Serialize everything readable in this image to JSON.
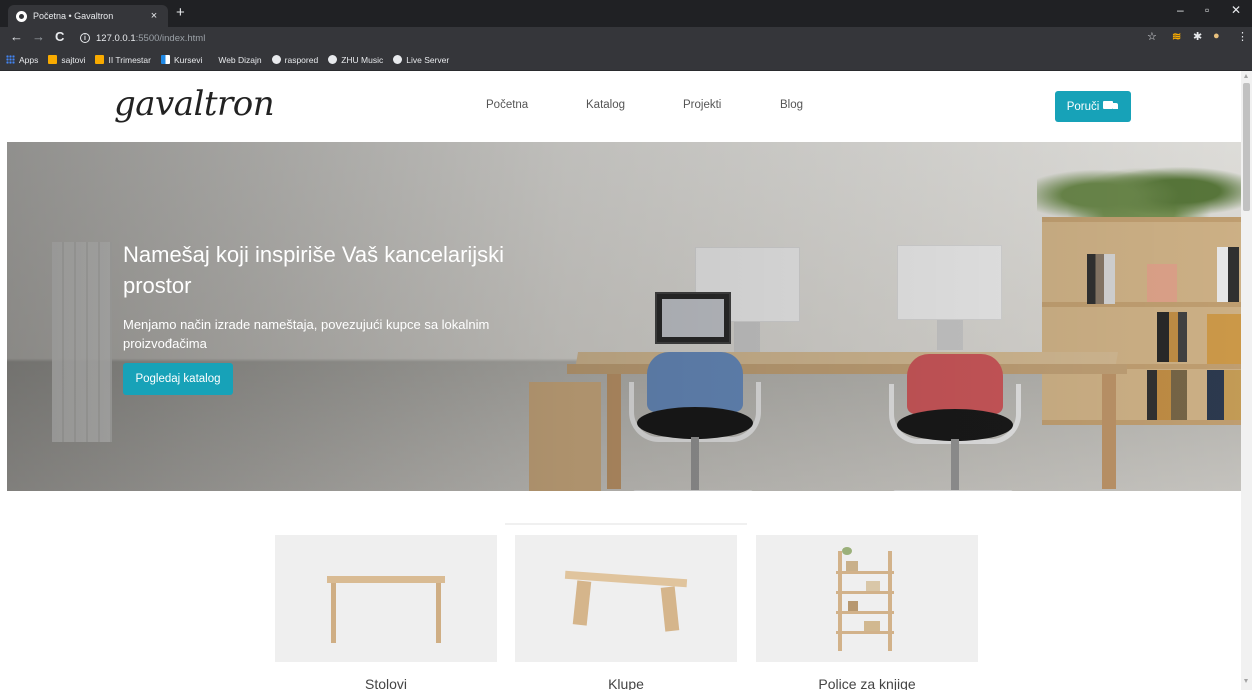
{
  "browser": {
    "tab_title": "Početna • Gavaltron",
    "tab_close": "×",
    "new_tab": "+",
    "url_host": "127.0.0.1",
    "url_path": ":5500/index.html",
    "bookmarks": [
      {
        "label": "Apps",
        "icon": "apps-grid-icon"
      },
      {
        "label": "sajtovi",
        "icon": "folder-icon"
      },
      {
        "label": "II Trimestar",
        "icon": "folder-icon"
      },
      {
        "label": "Kursevi",
        "icon": "ms-icon"
      },
      {
        "label": "Web Dizajn",
        "icon": "none"
      },
      {
        "label": "raspored",
        "icon": "globe-icon"
      },
      {
        "label": "ZHU Music",
        "icon": "globe-icon"
      },
      {
        "label": "Live Server",
        "icon": "globe-icon"
      }
    ]
  },
  "site": {
    "logo": "gavaltron",
    "nav": [
      "Početna",
      "Katalog",
      "Projekti",
      "Blog"
    ],
    "order_button": "Poruči",
    "accent_color": "#17a2b8"
  },
  "hero": {
    "title": "Namešaj koji inspiriše Vaš kancelarijski prostor",
    "subtitle": "Menjamo način izrade nameštaja, povezujući kupce sa lokalnim proizvođačima",
    "button": "Pogledaj katalog"
  },
  "categories": [
    {
      "label": "Stolovi"
    },
    {
      "label": "Klupe"
    },
    {
      "label": "Police za knjige"
    }
  ]
}
